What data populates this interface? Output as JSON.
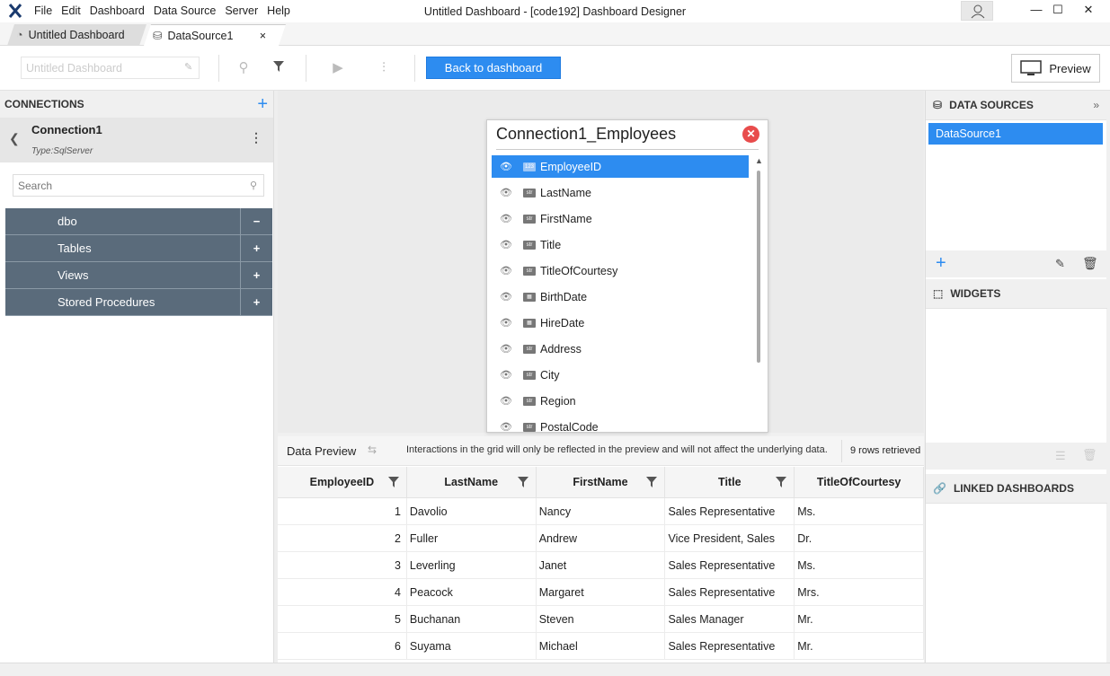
{
  "menu": [
    "File",
    "Edit",
    "Dashboard",
    "Data Source",
    "Server",
    "Help"
  ],
  "window_title": "Untitled Dashboard - [code192] Dashboard Designer",
  "tabs": [
    {
      "label": "Untitled Dashboard"
    },
    {
      "label": "DataSource1",
      "close": "×"
    }
  ],
  "toolbar": {
    "dashboard_name_placeholder": "Untitled Dashboard",
    "back_label": "Back to dashboard",
    "preview_label": "Preview"
  },
  "connections": {
    "header": "CONNECTIONS",
    "add": "+",
    "connection_name": "Connection1",
    "connection_type": "Type:SqlServer",
    "search_placeholder": "Search",
    "tree": [
      {
        "label": "dbo",
        "toggle": "−"
      },
      {
        "label": "Tables",
        "toggle": "+"
      },
      {
        "label": "Views",
        "toggle": "+"
      },
      {
        "label": "Stored Procedures",
        "toggle": "+"
      }
    ]
  },
  "datasource_card": {
    "title": "Connection1_Employees",
    "fields": [
      {
        "name": "EmployeeID",
        "type": "123"
      },
      {
        "name": "LastName",
        "type": "str"
      },
      {
        "name": "FirstName",
        "type": "str"
      },
      {
        "name": "Title",
        "type": "str"
      },
      {
        "name": "TitleOfCourtesy",
        "type": "str"
      },
      {
        "name": "BirthDate",
        "type": "date"
      },
      {
        "name": "HireDate",
        "type": "date"
      },
      {
        "name": "Address",
        "type": "str"
      },
      {
        "name": "City",
        "type": "str"
      },
      {
        "name": "Region",
        "type": "str"
      },
      {
        "name": "PostalCode",
        "type": "str"
      }
    ]
  },
  "preview": {
    "title": "Data Preview",
    "message": "Interactions in the grid will only be reflected in the preview and will not affect the underlying data.",
    "count": "9 rows retrieved",
    "columns": [
      "EmployeeID",
      "LastName",
      "FirstName",
      "Title",
      "TitleOfCourtesy"
    ],
    "rows": [
      [
        "1",
        "Davolio",
        "Nancy",
        "Sales Representative",
        "Ms."
      ],
      [
        "2",
        "Fuller",
        "Andrew",
        "Vice President, Sales",
        "Dr."
      ],
      [
        "3",
        "Leverling",
        "Janet",
        "Sales Representative",
        "Ms."
      ],
      [
        "4",
        "Peacock",
        "Margaret",
        "Sales Representative",
        "Mrs."
      ],
      [
        "5",
        "Buchanan",
        "Steven",
        "Sales Manager",
        "Mr."
      ],
      [
        "6",
        "Suyama",
        "Michael",
        "Sales Representative",
        "Mr."
      ]
    ]
  },
  "right": {
    "datasources_header": "DATA SOURCES",
    "datasource_item": "DataSource1",
    "widgets_header": "WIDGETS",
    "linked_header": "LINKED DASHBOARDS"
  },
  "colors": {
    "accent": "#2d8cf0",
    "tree_bg": "#5a6b7b",
    "close_red": "#e84c4c"
  }
}
